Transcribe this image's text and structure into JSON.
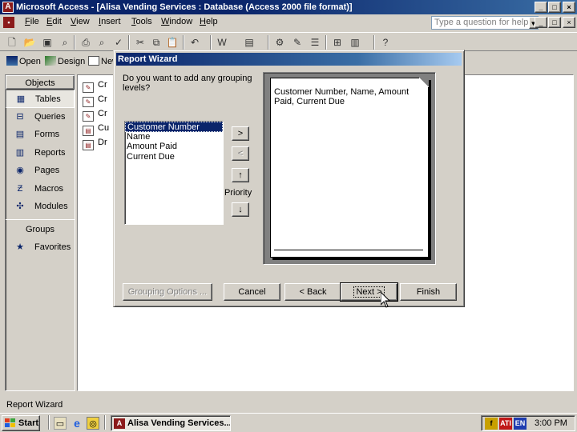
{
  "window": {
    "title": "Microsoft Access - [Alisa Vending Services : Database (Access 2000 file format)]",
    "min": "_",
    "max": "□",
    "close": "×"
  },
  "menu": {
    "items": [
      "File",
      "Edit",
      "View",
      "Insert",
      "Tools",
      "Window",
      "Help"
    ],
    "help_placeholder": "Type a question for help",
    "doc_min": "_",
    "doc_restore": "□",
    "doc_close": "×"
  },
  "db_toolbar": {
    "open": "Open",
    "design": "Design",
    "new": "New"
  },
  "objects_bar": {
    "header": "Objects",
    "items": [
      "Tables",
      "Queries",
      "Forms",
      "Reports",
      "Pages",
      "Macros",
      "Modules"
    ],
    "groups_header": "Groups",
    "groups": [
      "Favorites"
    ]
  },
  "list_items": [
    "Cr",
    "Cr",
    "Cr",
    "Cu",
    "Dr"
  ],
  "wizard": {
    "title": "Report Wizard",
    "question": "Do you want to add any grouping levels?",
    "fields": [
      "Customer Number",
      "Name",
      "Amount Paid",
      "Current Due"
    ],
    "add_btn": ">",
    "remove_btn": "<",
    "priority_up": "↑",
    "priority_down": "↓",
    "priority_label": "Priority",
    "preview_text": "Customer Number, Name, Amount Paid, Current Due",
    "buttons": {
      "grouping_options": "Grouping Options ...",
      "cancel": "Cancel",
      "back": "< Back",
      "next": "Next >",
      "finish": "Finish"
    }
  },
  "status": {
    "text": "Report Wizard"
  },
  "taskbar": {
    "start": "Start",
    "task": "Alisa Vending Services...",
    "lang": "EN",
    "clock": "3:00 PM"
  },
  "colors": {
    "titlebar": "#0a246a",
    "face": "#d4d0c8",
    "selection": "#0a246a"
  }
}
